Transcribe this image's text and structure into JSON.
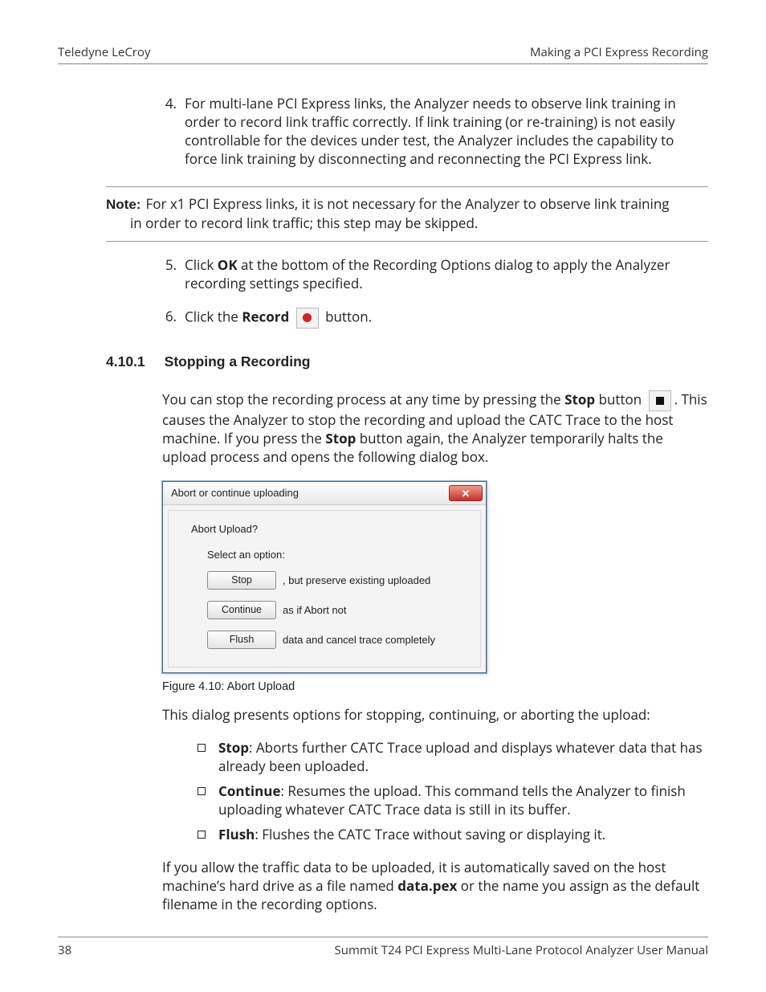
{
  "header": {
    "left": "Teledyne LeCroy",
    "right": "Making a PCI Express Recording"
  },
  "steps": {
    "s4": {
      "num": "4.",
      "text": "For multi-lane PCI Express links, the Analyzer needs to observe link training in order to record link traffic correctly. If link training (or re-training) is not easily controllable for the devices under test, the Analyzer includes the capability to force link training by disconnecting and reconnecting the PCI Express link."
    },
    "s5": {
      "num": "5.",
      "pre": "Click ",
      "bold": "OK",
      "post": " at the bottom of the Recording Options dialog to apply the Analyzer recording settings specified."
    },
    "s6": {
      "num": "6.",
      "pre": "Click the ",
      "bold": "Record",
      "post": " button."
    }
  },
  "note": {
    "label": "Note:",
    "line1": "For x1 PCI Express links, it is not necessary for the Analyzer to observe link training",
    "line2": "in order to record link traffic; this step may be skipped."
  },
  "section": {
    "num": "4.10.1",
    "title": "Stopping a Recording"
  },
  "stopping": {
    "p1a": "You can stop the recording process at any time by pressing the ",
    "p1bold": "Stop",
    "p1b": " button ",
    "p1c": ". This causes the Analyzer to stop the recording and upload the CATC Trace to the host machine. If you press the ",
    "p1bold2": "Stop",
    "p1d": " button again, the Analyzer temporarily halts the upload process and opens the following dialog box."
  },
  "dialog": {
    "title": "Abort or continue uploading",
    "question": "Abort Upload?",
    "select": "Select an option:",
    "opts": {
      "stop": {
        "btn": "Stop",
        "txt": ", but preserve existing uploaded"
      },
      "cont": {
        "btn": "Continue",
        "txt": "as if Abort not"
      },
      "flush": {
        "btn": "Flush",
        "txt": "data and cancel trace completely"
      }
    }
  },
  "figcap": "Figure 4.10:  Abort Upload",
  "afterDialog": "This dialog presents options for stopping, continuing, or aborting the upload:",
  "bullets": {
    "b1": {
      "bold": "Stop",
      "txt": ": Aborts further CATC Trace upload and displays whatever data that has already been uploaded."
    },
    "b2": {
      "bold": "Continue",
      "txt": ": Resumes the upload. This command tells the Analyzer to finish uploading whatever CATC Trace data is still in its buffer."
    },
    "b3": {
      "bold": "Flush",
      "txt": ": Flushes the CATC Trace without saving or displaying it."
    }
  },
  "closing": {
    "a": "If you allow the traffic data to be uploaded, it is automatically saved on the host machine’s hard drive as a file named ",
    "file": "data.pex",
    "b": " or the name you assign as the default filename in the recording options."
  },
  "footer": {
    "page": "38",
    "title": "Summit T24 PCI Express Multi-Lane Protocol Analyzer User Manual"
  }
}
